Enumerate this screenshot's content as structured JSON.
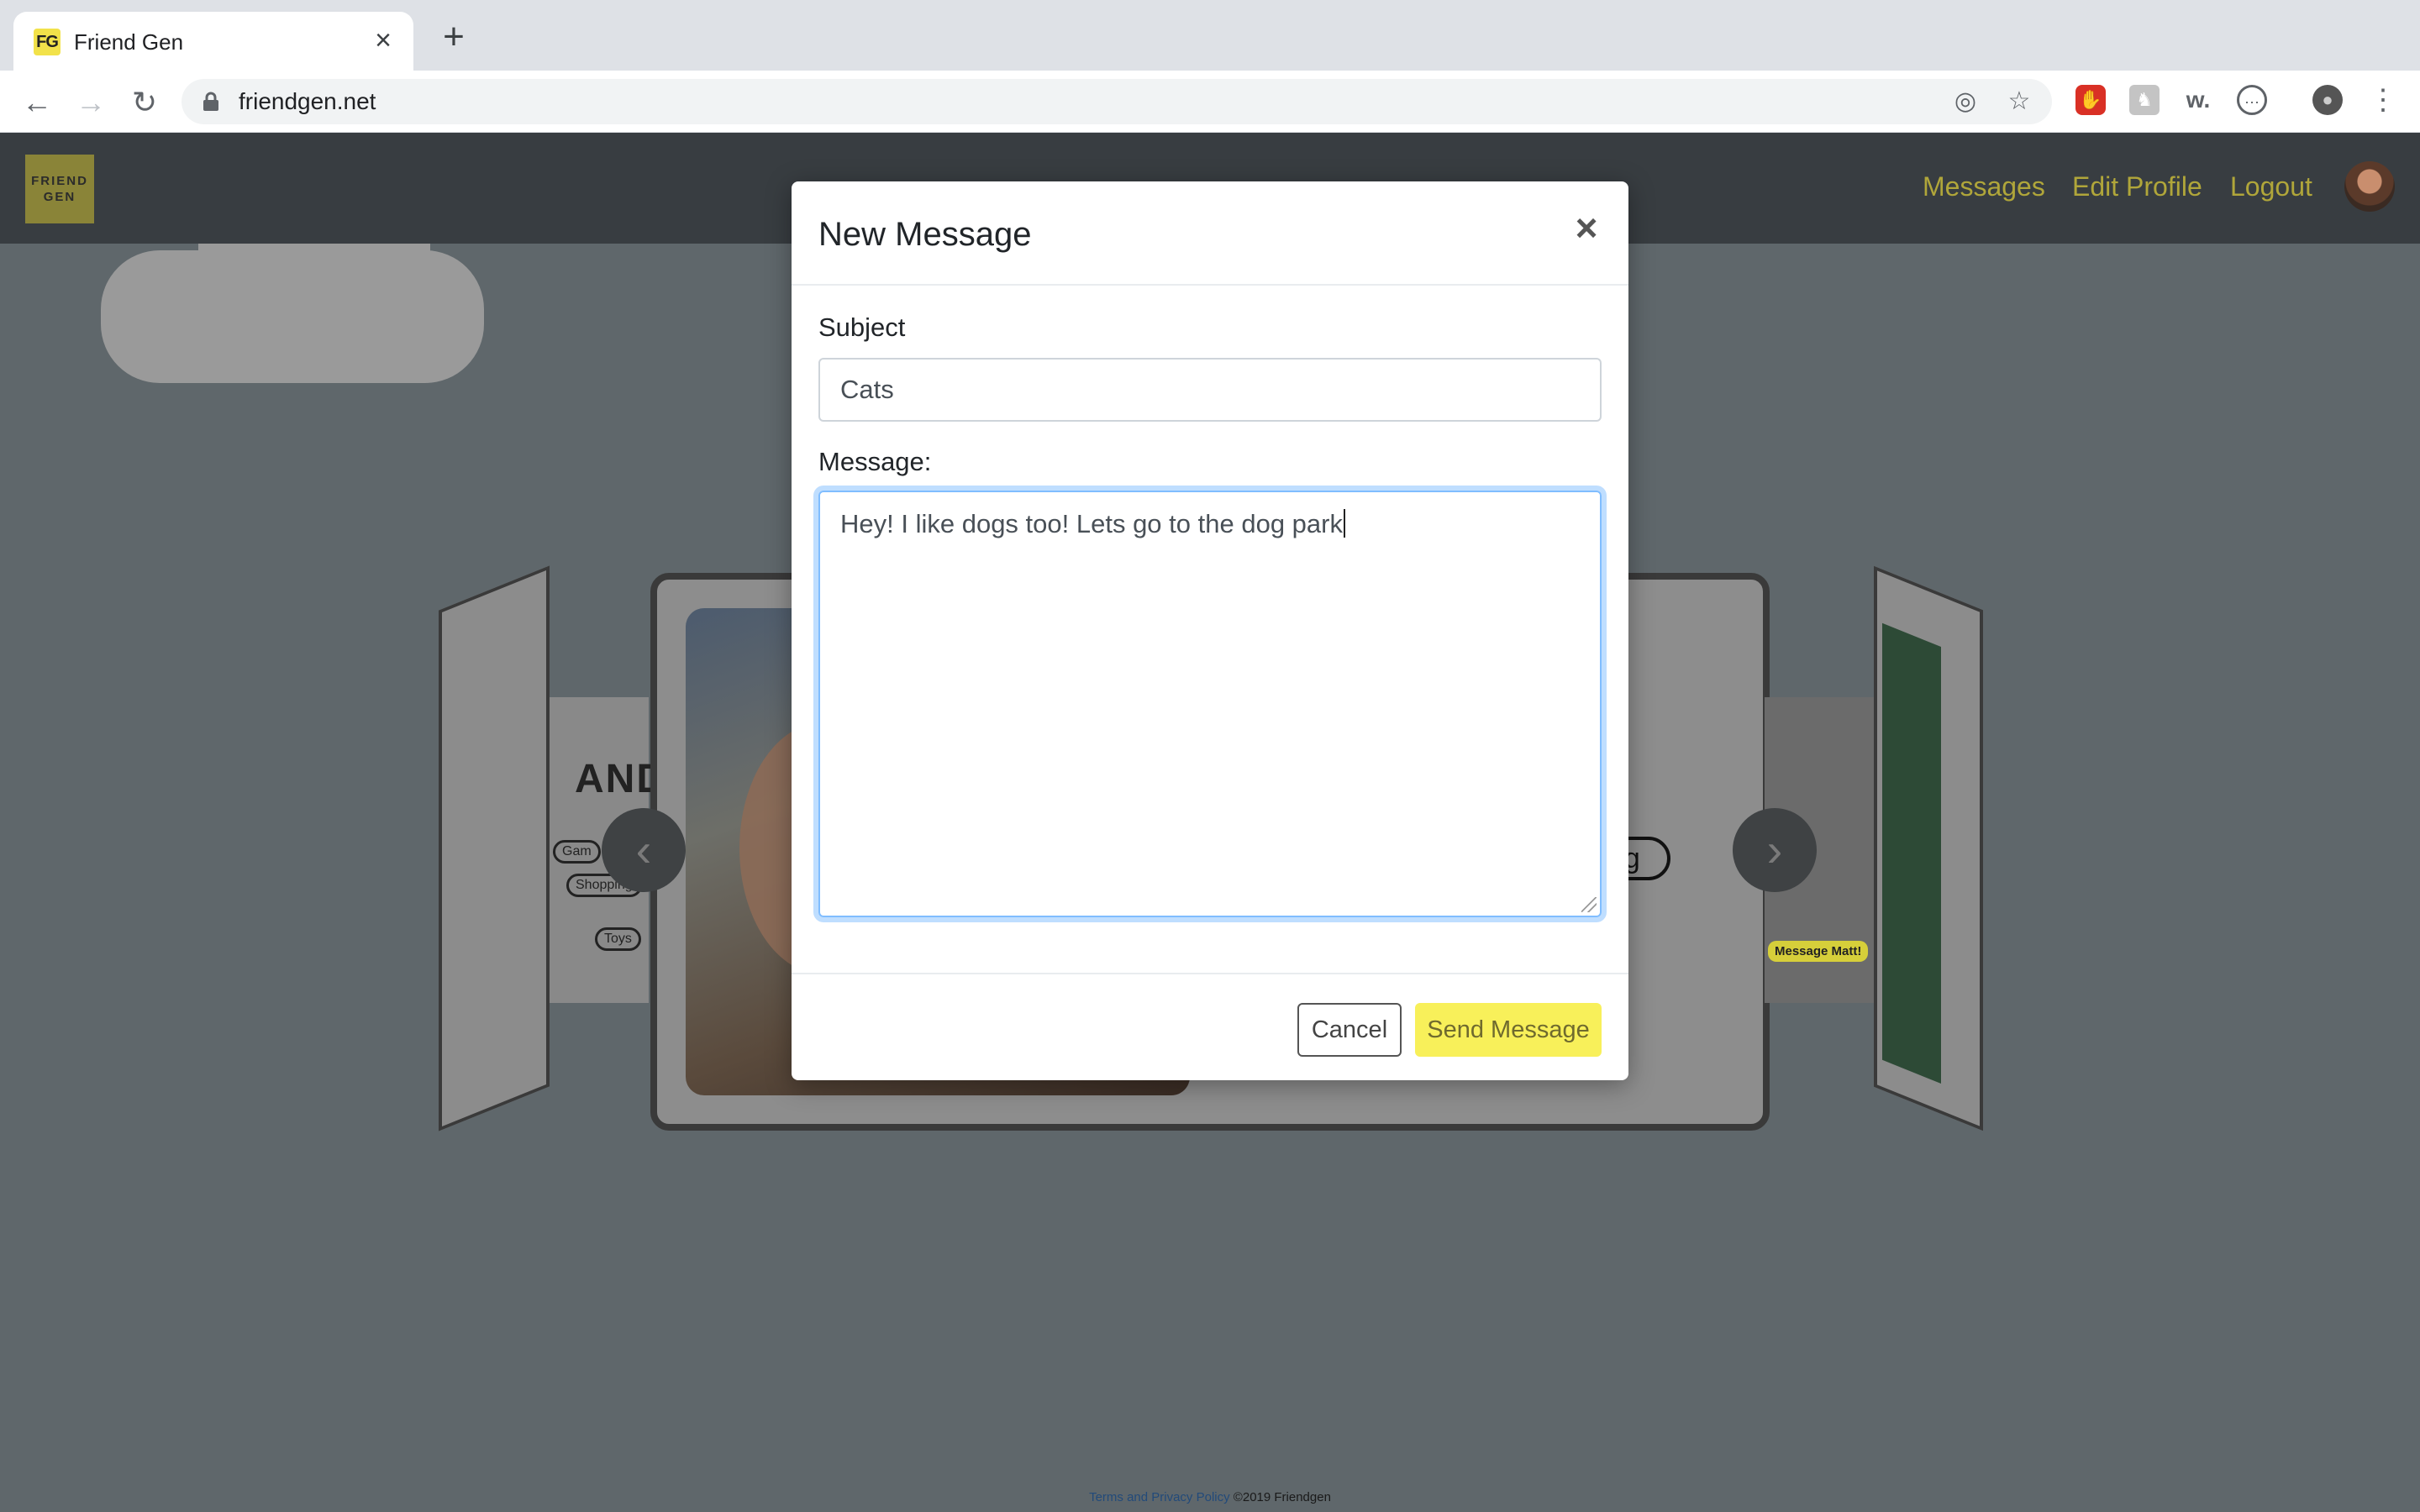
{
  "browser": {
    "tab_title": "Friend Gen",
    "tab_favicon_text": "FG",
    "url": "friendgen.net",
    "new_tab_symbol": "+",
    "close_symbol": "×"
  },
  "site": {
    "logo_line1": "FRIEND",
    "logo_line2": "GEN",
    "nav": {
      "messages": "Messages",
      "edit_profile": "Edit Profile",
      "logout": "Logout"
    },
    "accent_color": "#b0a63a"
  },
  "background": {
    "left_card_name": "ANDY",
    "left_card_tags": [
      "Gam",
      "Shopping",
      "Toys"
    ],
    "right_pill_text": "ng",
    "right_card_tag": "Message Matt!"
  },
  "modal": {
    "title": "New Message",
    "close_symbol": "×",
    "subject_label": "Subject",
    "subject_value": "Cats",
    "message_label": "Message:",
    "message_value": "Hey! I like dogs too! Lets go to the dog park",
    "cancel_label": "Cancel",
    "send_label": "Send Message",
    "send_color": "#f8f05a"
  },
  "footer": {
    "link_text": "Terms and Privacy Policy",
    "copyright": "©2019 Friendgen"
  }
}
